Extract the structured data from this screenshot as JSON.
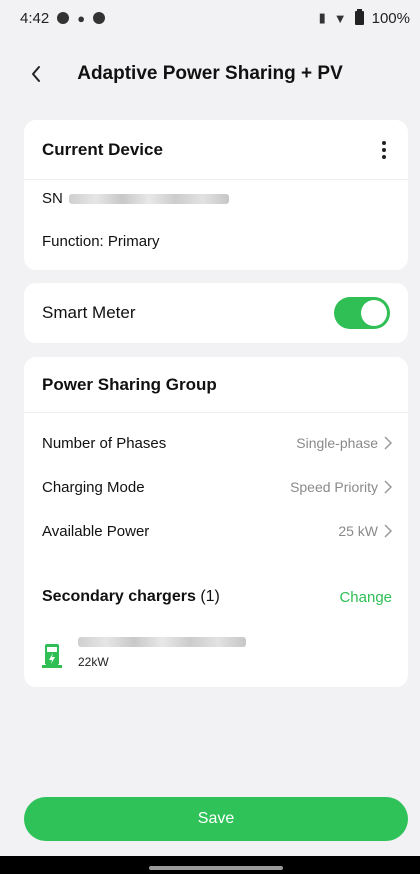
{
  "status_bar": {
    "time": "4:42",
    "battery": "100%"
  },
  "header": {
    "title": "Adaptive Power Sharing + PV"
  },
  "current_device": {
    "title": "Current Device",
    "sn_label": "SN",
    "function_text": "Function: Primary"
  },
  "smart_meter": {
    "label": "Smart Meter",
    "enabled": true
  },
  "power_sharing_group": {
    "title": "Power Sharing Group",
    "settings": [
      {
        "label": "Number of Phases",
        "value": "Single-phase"
      },
      {
        "label": "Charging Mode",
        "value": "Speed Priority"
      },
      {
        "label": "Available Power",
        "value": "25 kW"
      }
    ],
    "secondary_label": "Secondary chargers",
    "secondary_count": "(1)",
    "change_label": "Change",
    "chargers": [
      {
        "power": "22kW"
      }
    ]
  },
  "save_label": "Save",
  "colors": {
    "accent": "#2fbf55",
    "background": "#f2f2f4"
  },
  "icons": [
    "back-icon",
    "more-vertical-icon",
    "ev-charger-icon",
    "chevron-right-icon"
  ]
}
